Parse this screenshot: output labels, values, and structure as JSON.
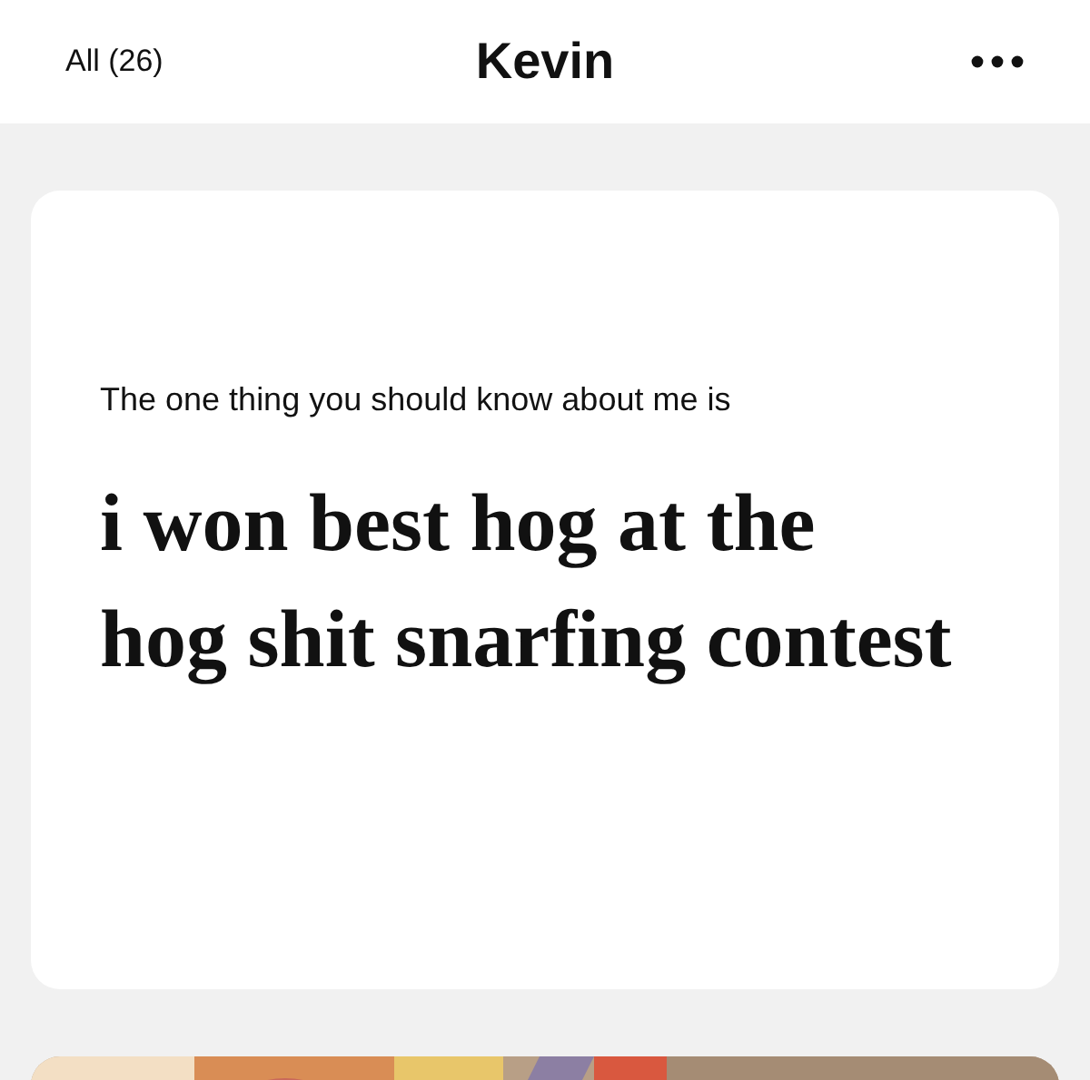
{
  "header": {
    "back_label": "All (26)",
    "title": "Kevin"
  },
  "prompt_card": {
    "prompt": "The one thing you should know about me is",
    "answer": "i won best hog at the hog shit snarfing contest"
  }
}
